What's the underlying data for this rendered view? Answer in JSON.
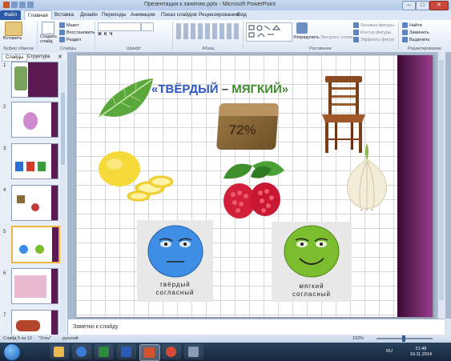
{
  "window": {
    "title": "Презентация к занятию.pptx - Microsoft PowerPoint",
    "min": "–",
    "max": "□",
    "close": "✕"
  },
  "tabs": {
    "file": "Файл",
    "items": [
      "Главная",
      "Вставка",
      "Дизайн",
      "Переходы",
      "Анимация",
      "Показ слайдов",
      "Рецензирование",
      "Вид"
    ]
  },
  "ribbon": {
    "paste": "Вставить",
    "clipboard": "Буфер обмена",
    "new_slide": "Создать слайд",
    "layout": "Макет",
    "reset": "Восстановить",
    "section": "Раздел",
    "slides": "Слайды",
    "font": "Шрифт",
    "paragraph": "Абзац",
    "arrange": "Упорядочить",
    "quick_styles": "Экспресс-стили",
    "shape_fill": "Заливка фигуры",
    "shape_outline": "Контур фигуры",
    "shape_effects": "Эффекты фигур",
    "drawing": "Рисование",
    "find": "Найти",
    "replace": "Заменить",
    "select": "Выделить",
    "editing": "Редактирование"
  },
  "panel": {
    "tab_slides": "Слайды",
    "tab_outline": "Структура",
    "numbers": [
      "1",
      "2",
      "3",
      "4",
      "5",
      "6",
      "7"
    ]
  },
  "slide": {
    "title_open": "«ТВЁРДЫЙ",
    "title_dash": " – ",
    "title_close": "МЯГКИЙ»",
    "soap_text": "72%",
    "hard_label_1": "твёрдый",
    "hard_label_2": "согласный",
    "soft_label_1": "мягкий",
    "soft_label_2": "согласный"
  },
  "notes": {
    "placeholder": "Заметки к слайду"
  },
  "status": {
    "slide": "Слайд 5 из 12",
    "theme": "\"Углы\"",
    "lang": "русский",
    "zoom": "102%"
  },
  "taskbar": {
    "lang": "RU",
    "time": "21:48",
    "date": "10.11.2014"
  },
  "colors": {
    "hard": "#3f8ee6",
    "soft": "#7bbd2e",
    "band": "#6b1f60",
    "title_hard": "#2f57c4",
    "title_soft": "#3f8c2c"
  }
}
